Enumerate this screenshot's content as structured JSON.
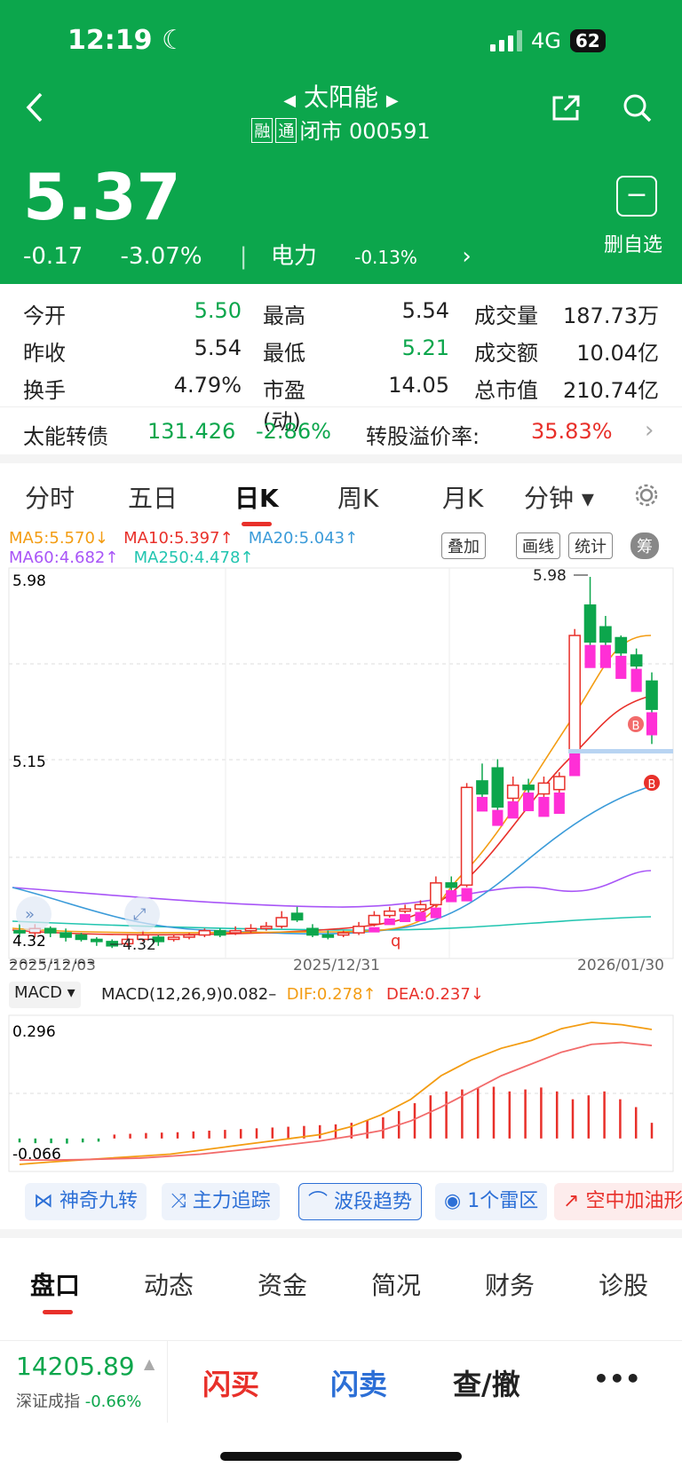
{
  "status": {
    "time": "12:19",
    "network": "4G",
    "battery": "62"
  },
  "nav": {
    "title": "太阳能",
    "tag1": "融",
    "tag2": "通",
    "subtitle": "闭市 000591"
  },
  "quote": {
    "price": "5.37",
    "change": "-0.17",
    "change_pct": "-3.07%",
    "sector": "电力",
    "sector_pct": "-0.13%"
  },
  "watch": {
    "label": "删自选",
    "icon": "−"
  },
  "stats": [
    {
      "l1": "今开",
      "v1": "5.50",
      "l2": "最高",
      "v2": "5.54",
      "l3": "成交量",
      "v3": "187.73万"
    },
    {
      "l1": "昨收",
      "v1": "5.54",
      "l2": "最低",
      "v2": "5.21",
      "l3": "成交额",
      "v3": "10.04亿"
    },
    {
      "l1": "换手",
      "v1": "4.79%",
      "l2": "市盈(动)",
      "v2": "14.05",
      "l3": "总市值",
      "v3": "210.74亿"
    }
  ],
  "bond": {
    "name": "太能转债",
    "price": "131.426",
    "pct": "-2.86%",
    "premium_label": "转股溢价率:",
    "premium": "35.83%"
  },
  "ktabs": [
    "分时",
    "五日",
    "日K",
    "周K",
    "月K",
    "分钟 ▾"
  ],
  "ma": {
    "ma5": "MA5:5.570↓",
    "ma10": "MA10:5.397↑",
    "ma20": "MA20:5.043↑",
    "ma60": "MA60:4.682↑",
    "ma250": "MA250:4.478↑"
  },
  "chips": {
    "overlay": "叠加",
    "draw": "画线",
    "stats": "统计",
    "chip": "筹"
  },
  "axis": {
    "top": "5.98",
    "mid": "5.15",
    "bottom": "4.32",
    "high_mark": "5.98",
    "low_mark": "4.32",
    "d1": "2025/12/03",
    "d2": "2025/12/31",
    "d3": "2026/01/30",
    "q": "q",
    "b": "B"
  },
  "macd": {
    "sel": "MACD ▾",
    "title": "MACD(12,26,9)0.082–",
    "dif": "DIF:0.278↑",
    "dea": "DEA:0.237↓",
    "top": "0.296",
    "bottom": "-0.066"
  },
  "funcs": [
    "神奇九转",
    "主力追踪",
    "波段趋势",
    "1个雷区",
    "空中加油形"
  ],
  "bottom_tabs": [
    "盘口",
    "动态",
    "资金",
    "简况",
    "财务",
    "诊股"
  ],
  "index": {
    "value": "14205.89",
    "name": "深证成指",
    "pct": "-0.66%"
  },
  "trade": {
    "buy": "闪买",
    "sell": "闪卖",
    "query": "查/撤",
    "more": "•••"
  },
  "colors": {
    "up": "#e8302a",
    "down": "#0ca64c",
    "header": "#0ca64c"
  },
  "chart_data": {
    "type": "candlestick",
    "xlabels": [
      "2025/12/03",
      "2025/12/31",
      "2026/01/30"
    ],
    "ylim": [
      4.32,
      5.98
    ],
    "candles": [
      {
        "o": 4.35,
        "c": 4.34,
        "h": 4.38,
        "l": 4.32
      },
      {
        "o": 4.34,
        "c": 4.36,
        "h": 4.38,
        "l": 4.32
      },
      {
        "o": 4.36,
        "c": 4.34,
        "h": 4.37,
        "l": 4.32
      },
      {
        "o": 4.34,
        "c": 4.32,
        "h": 4.36,
        "l": 4.3
      },
      {
        "o": 4.33,
        "c": 4.31,
        "h": 4.34,
        "l": 4.3
      },
      {
        "o": 4.31,
        "c": 4.3,
        "h": 4.32,
        "l": 4.28
      },
      {
        "o": 4.3,
        "c": 4.28,
        "h": 4.31,
        "l": 4.27
      },
      {
        "o": 4.29,
        "c": 4.31,
        "h": 4.33,
        "l": 4.28
      },
      {
        "o": 4.31,
        "c": 4.33,
        "h": 4.35,
        "l": 4.3
      },
      {
        "o": 4.32,
        "c": 4.3,
        "h": 4.33,
        "l": 4.28
      },
      {
        "o": 4.31,
        "c": 4.32,
        "h": 4.33,
        "l": 4.3
      },
      {
        "o": 4.32,
        "c": 4.33,
        "h": 4.34,
        "l": 4.31
      },
      {
        "o": 4.33,
        "c": 4.35,
        "h": 4.36,
        "l": 4.32
      },
      {
        "o": 4.35,
        "c": 4.33,
        "h": 4.36,
        "l": 4.32
      },
      {
        "o": 4.34,
        "c": 4.35,
        "h": 4.37,
        "l": 4.33
      },
      {
        "o": 4.35,
        "c": 4.36,
        "h": 4.38,
        "l": 4.34
      },
      {
        "o": 4.36,
        "c": 4.37,
        "h": 4.39,
        "l": 4.35
      },
      {
        "o": 4.37,
        "c": 4.41,
        "h": 4.44,
        "l": 4.36
      },
      {
        "o": 4.43,
        "c": 4.4,
        "h": 4.46,
        "l": 4.39
      },
      {
        "o": 4.36,
        "c": 4.33,
        "h": 4.38,
        "l": 4.32
      },
      {
        "o": 4.33,
        "c": 4.32,
        "h": 4.35,
        "l": 4.31
      },
      {
        "o": 4.33,
        "c": 4.34,
        "h": 4.35,
        "l": 4.32
      },
      {
        "o": 4.34,
        "c": 4.37,
        "h": 4.39,
        "l": 4.33
      },
      {
        "o": 4.38,
        "c": 4.42,
        "h": 4.44,
        "l": 4.37
      },
      {
        "o": 4.42,
        "c": 4.44,
        "h": 4.46,
        "l": 4.41
      },
      {
        "o": 4.44,
        "c": 4.45,
        "h": 4.47,
        "l": 4.43
      },
      {
        "o": 4.45,
        "c": 4.47,
        "h": 4.49,
        "l": 4.44
      },
      {
        "o": 4.47,
        "c": 4.57,
        "h": 4.6,
        "l": 4.46
      },
      {
        "o": 4.57,
        "c": 4.55,
        "h": 4.6,
        "l": 4.53
      },
      {
        "o": 4.56,
        "c": 5.01,
        "h": 5.03,
        "l": 4.55
      },
      {
        "o": 5.04,
        "c": 4.98,
        "h": 5.12,
        "l": 4.95
      },
      {
        "o": 5.1,
        "c": 4.92,
        "h": 5.14,
        "l": 4.9
      },
      {
        "o": 4.96,
        "c": 5.02,
        "h": 5.06,
        "l": 4.92
      },
      {
        "o": 5.02,
        "c": 5.0,
        "h": 5.05,
        "l": 4.98
      },
      {
        "o": 4.98,
        "c": 5.03,
        "h": 5.06,
        "l": 4.96
      },
      {
        "o": 5.0,
        "c": 5.06,
        "h": 5.08,
        "l": 4.98
      },
      {
        "o": 5.18,
        "c": 5.71,
        "h": 5.74,
        "l": 5.16
      },
      {
        "o": 5.85,
        "c": 5.68,
        "h": 5.98,
        "l": 5.62
      },
      {
        "o": 5.75,
        "c": 5.68,
        "h": 5.8,
        "l": 5.64
      },
      {
        "o": 5.7,
        "c": 5.63,
        "h": 5.71,
        "l": 5.55
      },
      {
        "o": 5.62,
        "c": 5.57,
        "h": 5.65,
        "l": 5.52
      },
      {
        "o": 5.5,
        "c": 5.37,
        "h": 5.54,
        "l": 5.21
      }
    ],
    "macd_hist": [
      -0.01,
      -0.012,
      -0.012,
      -0.013,
      -0.01,
      -0.008,
      0.01,
      0.012,
      0.014,
      0.015,
      0.016,
      0.018,
      0.02,
      0.022,
      0.024,
      0.026,
      0.028,
      0.03,
      0.032,
      0.034,
      0.036,
      0.04,
      0.046,
      0.054,
      0.07,
      0.09,
      0.11,
      0.12,
      0.125,
      0.13,
      0.132,
      0.12,
      0.125,
      0.13,
      0.12,
      0.1,
      0.11,
      0.12,
      0.1,
      0.08,
      0.04
    ],
    "dif": [
      -0.066,
      -0.06,
      -0.055,
      -0.05,
      -0.045,
      -0.04,
      -0.03,
      -0.02,
      -0.01,
      0.0,
      0.01,
      0.03,
      0.06,
      0.1,
      0.16,
      0.2,
      0.23,
      0.25,
      0.28,
      0.296,
      0.29,
      0.278
    ],
    "dea": [
      -0.055,
      -0.055,
      -0.054,
      -0.052,
      -0.05,
      -0.045,
      -0.04,
      -0.032,
      -0.024,
      -0.015,
      -0.006,
      0.006,
      0.02,
      0.045,
      0.08,
      0.12,
      0.16,
      0.19,
      0.22,
      0.24,
      0.245,
      0.237
    ]
  }
}
